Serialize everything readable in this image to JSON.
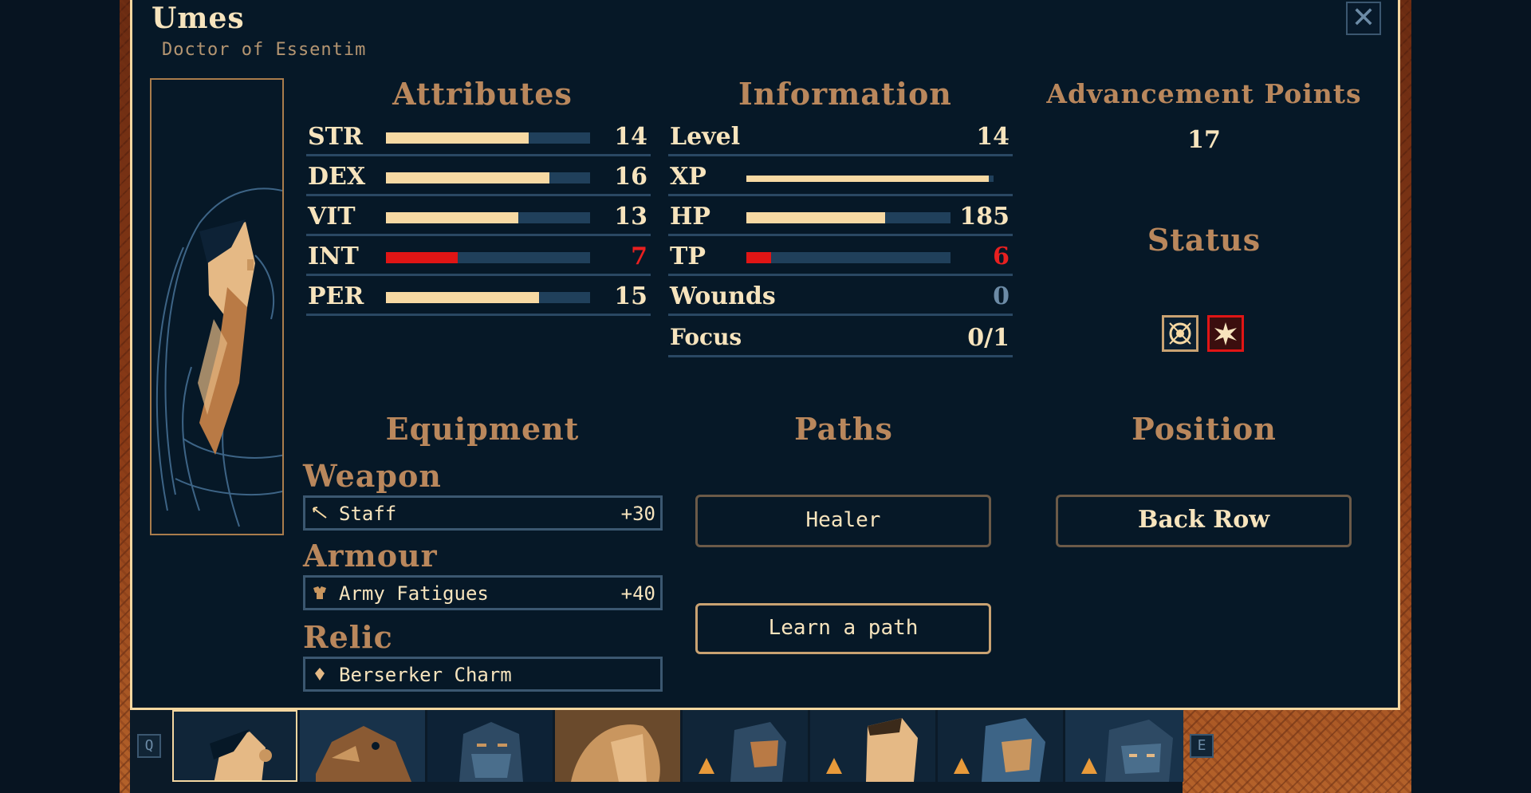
{
  "character": {
    "name": "Umes",
    "class": "Doctor of Essentim"
  },
  "sections": {
    "attributes": "Attributes",
    "information": "Information",
    "advancement": "Advancement Points",
    "status": "Status",
    "equipment": "Equipment",
    "paths": "Paths",
    "position": "Position"
  },
  "attributes": [
    {
      "label": "STR",
      "value": "14",
      "fill": 0.7,
      "state": "normal"
    },
    {
      "label": "DEX",
      "value": "16",
      "fill": 0.8,
      "state": "normal"
    },
    {
      "label": "VIT",
      "value": "13",
      "fill": 0.65,
      "state": "normal"
    },
    {
      "label": "INT",
      "value": "7",
      "fill": 0.35,
      "state": "low"
    },
    {
      "label": "PER",
      "value": "15",
      "fill": 0.75,
      "state": "normal"
    }
  ],
  "information": {
    "level": {
      "label": "Level",
      "value": "14"
    },
    "xp": {
      "label": "XP",
      "fill": 0.98
    },
    "hp": {
      "label": "HP",
      "value": "185",
      "fill": 0.68
    },
    "tp": {
      "label": "TP",
      "value": "6",
      "fill": 0.12
    },
    "wounds": {
      "label": "Wounds",
      "value": "0"
    },
    "focus": {
      "label": "Focus",
      "value": "0/1"
    }
  },
  "advancement_points": "17",
  "status_icons": [
    "shield-status-icon",
    "burst-status-icon"
  ],
  "equipment": {
    "weapon": {
      "title": "Weapon",
      "name": "Staff",
      "bonus": "+30",
      "icon": "staff-icon"
    },
    "armour": {
      "title": "Armour",
      "name": "Army Fatigues",
      "bonus": "+40",
      "icon": "armour-icon"
    },
    "relic": {
      "title": "Relic",
      "name": "Berserker Charm",
      "icon": "charm-icon"
    }
  },
  "paths": {
    "current": "Healer",
    "learn": "Learn a path"
  },
  "position": "Back Row",
  "party_bar": {
    "prev_key": "Q",
    "next_key": "E"
  },
  "close_glyph": "✕",
  "colors": {
    "accent": "#f7d9a3",
    "heading": "#b9875c",
    "panel_bg": "#061827",
    "low_stat": "#e01515"
  }
}
